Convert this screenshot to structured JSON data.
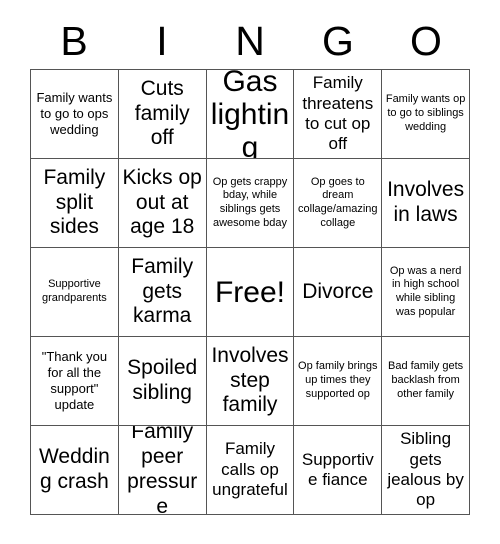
{
  "card": {
    "header_letters": [
      "B",
      "I",
      "N",
      "G",
      "O"
    ],
    "free_space_label": "Free!",
    "rows": [
      [
        {
          "text": "Family wants to go to ops wedding",
          "size": "sm"
        },
        {
          "text": "Cuts family off",
          "size": "lg"
        },
        {
          "text": "Gas lighting",
          "size": "xl"
        },
        {
          "text": "Family threatens to cut op off",
          "size": "md"
        },
        {
          "text": "Family wants op to go to siblings wedding",
          "size": "xs"
        }
      ],
      [
        {
          "text": "Family split sides",
          "size": "lg"
        },
        {
          "text": "Kicks op out at age 18",
          "size": "lg"
        },
        {
          "text": "Op gets crappy bday, while siblings gets awesome bday",
          "size": "xs"
        },
        {
          "text": "Op goes to dream collage/amazing collage",
          "size": "xs"
        },
        {
          "text": "Involves in laws",
          "size": "lg"
        }
      ],
      [
        {
          "text": "Supportive grandparents",
          "size": "xs"
        },
        {
          "text": "Family gets karma",
          "size": "lg"
        },
        {
          "text": "Free!",
          "size": "xl"
        },
        {
          "text": "Divorce",
          "size": "lg"
        },
        {
          "text": "Op was a nerd in high school while sibling was popular",
          "size": "xs"
        }
      ],
      [
        {
          "text": "\"Thank you for all the support\" update",
          "size": "sm"
        },
        {
          "text": "Spoiled sibling",
          "size": "lg"
        },
        {
          "text": "Involves step family",
          "size": "lg"
        },
        {
          "text": "Op family brings up times they supported op",
          "size": "xs"
        },
        {
          "text": "Bad family gets backlash from other family",
          "size": "xs"
        }
      ],
      [
        {
          "text": "Wedding crash",
          "size": "lg"
        },
        {
          "text": "Family peer pressure",
          "size": "lg"
        },
        {
          "text": "Family calls op ungrateful",
          "size": "md"
        },
        {
          "text": "Supportive fiance",
          "size": "md"
        },
        {
          "text": "Sibling gets jealous by op",
          "size": "md"
        }
      ]
    ]
  },
  "colors": {
    "background": "#ffffff",
    "text": "#000000",
    "grid_line": "#555555"
  }
}
